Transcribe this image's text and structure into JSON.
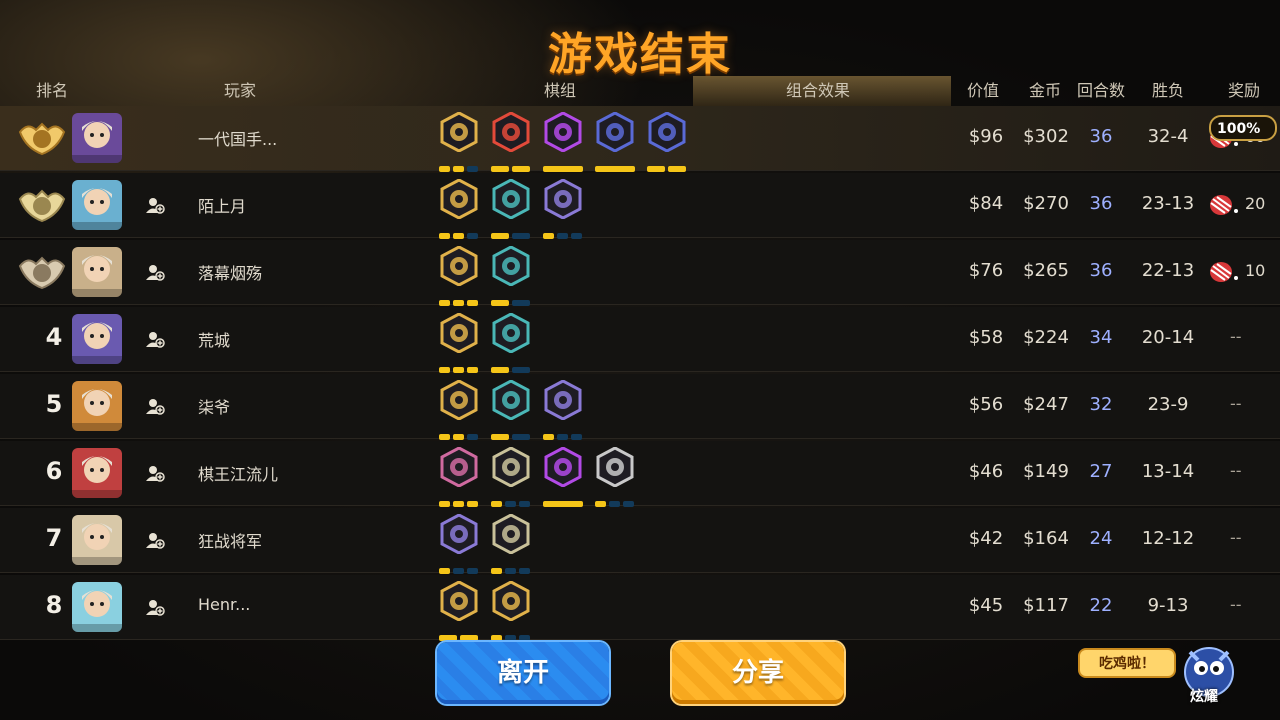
{
  "title": "游戏结束",
  "headers": {
    "rank": "排名",
    "player": "玩家",
    "pieces": "棋组",
    "synergy": "组合效果",
    "value": "价值",
    "gold": "金币",
    "rounds": "回合数",
    "winloss": "胜负",
    "reward": "奖励"
  },
  "bonus_badge": "100%",
  "colors": {
    "accent": "#ffa526",
    "rounds": "#9eb0ff",
    "bar_on": "#f5c518",
    "bar_off": "#123a5a"
  },
  "rows": [
    {
      "rank": "1",
      "name": "一代国手...",
      "value": "$96",
      "gold": "$302",
      "rounds": "36",
      "winloss": "32-4",
      "reward": "60",
      "medal": "gold-medal",
      "synergies": [
        {
          "icon": "gear",
          "color": "#e0b14a",
          "lvl": [
            1,
            1,
            0
          ]
        },
        {
          "icon": "demon-mask",
          "color": "#e24a3a",
          "lvl": [
            1,
            1
          ]
        },
        {
          "icon": "purple-demon",
          "color": "#b24ae6",
          "lvl": [
            1
          ]
        },
        {
          "icon": "wizard-hat",
          "color": "#5a6ad6",
          "lvl": [
            1
          ]
        },
        {
          "icon": "skeleton-fish",
          "color": "#5a6ad6",
          "lvl": [
            1,
            1
          ]
        }
      ]
    },
    {
      "rank": "2",
      "name": "陌上月",
      "value": "$84",
      "gold": "$270",
      "rounds": "36",
      "winloss": "23-13",
      "reward": "20",
      "medal": "silver-medal",
      "synergies": [
        {
          "icon": "knight-helm",
          "color": "#e0b14a",
          "lvl": [
            1,
            1,
            0
          ]
        },
        {
          "icon": "mystery",
          "color": "#4ab7b7",
          "lvl": [
            1,
            0
          ]
        },
        {
          "icon": "tome",
          "color": "#8a7ad6",
          "lvl": [
            1,
            0,
            0
          ]
        }
      ]
    },
    {
      "rank": "3",
      "name": "落幕烟殇",
      "value": "$76",
      "gold": "$265",
      "rounds": "36",
      "winloss": "22-13",
      "reward": "10",
      "medal": "bronze-medal",
      "synergies": [
        {
          "icon": "knight-helm",
          "color": "#e0b14a",
          "lvl": [
            1,
            1,
            1
          ]
        },
        {
          "icon": "mystery",
          "color": "#4ab7b7",
          "lvl": [
            1,
            0
          ]
        }
      ]
    },
    {
      "rank": "4",
      "name": "荒城",
      "value": "$58",
      "gold": "$224",
      "rounds": "34",
      "winloss": "20-14",
      "reward": "--",
      "medal": "",
      "synergies": [
        {
          "icon": "knight-helm",
          "color": "#e0b14a",
          "lvl": [
            1,
            1,
            1
          ]
        },
        {
          "icon": "mystery",
          "color": "#4ab7b7",
          "lvl": [
            1,
            0
          ]
        }
      ]
    },
    {
      "rank": "5",
      "name": "柒爷",
      "value": "$56",
      "gold": "$247",
      "rounds": "32",
      "winloss": "23-9",
      "reward": "--",
      "medal": "",
      "synergies": [
        {
          "icon": "knight-helm",
          "color": "#e0b14a",
          "lvl": [
            1,
            1,
            0
          ]
        },
        {
          "icon": "mystery",
          "color": "#4ab7b7",
          "lvl": [
            1,
            0
          ]
        },
        {
          "icon": "tome",
          "color": "#8a7ad6",
          "lvl": [
            1,
            0,
            0
          ]
        }
      ]
    },
    {
      "rank": "6",
      "name": "棋王江流儿",
      "value": "$46",
      "gold": "$149",
      "rounds": "27",
      "winloss": "13-14",
      "reward": "--",
      "medal": "",
      "synergies": [
        {
          "icon": "chess-knight",
          "color": "#d06aa0",
          "lvl": [
            1,
            1,
            1
          ]
        },
        {
          "icon": "beast",
          "color": "#c9c19a",
          "lvl": [
            1,
            0,
            0
          ]
        },
        {
          "icon": "purple-demon",
          "color": "#b24ae6",
          "lvl": [
            1
          ]
        },
        {
          "icon": "golem",
          "color": "#c9c9c9",
          "lvl": [
            1,
            0,
            0
          ]
        }
      ]
    },
    {
      "rank": "7",
      "name": "狂战将军",
      "value": "$42",
      "gold": "$164",
      "rounds": "24",
      "winloss": "12-12",
      "reward": "--",
      "medal": "",
      "synergies": [
        {
          "icon": "tome",
          "color": "#8a7ad6",
          "lvl": [
            1,
            0,
            0
          ]
        },
        {
          "icon": "beast",
          "color": "#c9c19a",
          "lvl": [
            1,
            0,
            0
          ]
        }
      ]
    },
    {
      "rank": "8",
      "name": "Henr...",
      "value": "$45",
      "gold": "$117",
      "rounds": "22",
      "winloss": "9-13",
      "reward": "--",
      "medal": "",
      "synergies": [
        {
          "icon": "claws",
          "color": "#e0b14a",
          "lvl": [
            1,
            1
          ]
        },
        {
          "icon": "knight-helm",
          "color": "#e0b14a",
          "lvl": [
            1,
            0,
            0
          ]
        }
      ]
    }
  ],
  "buttons": {
    "leave": "离开",
    "share": "分享"
  },
  "brag": {
    "bubble": "吃鸡啦！",
    "label": "炫耀"
  }
}
